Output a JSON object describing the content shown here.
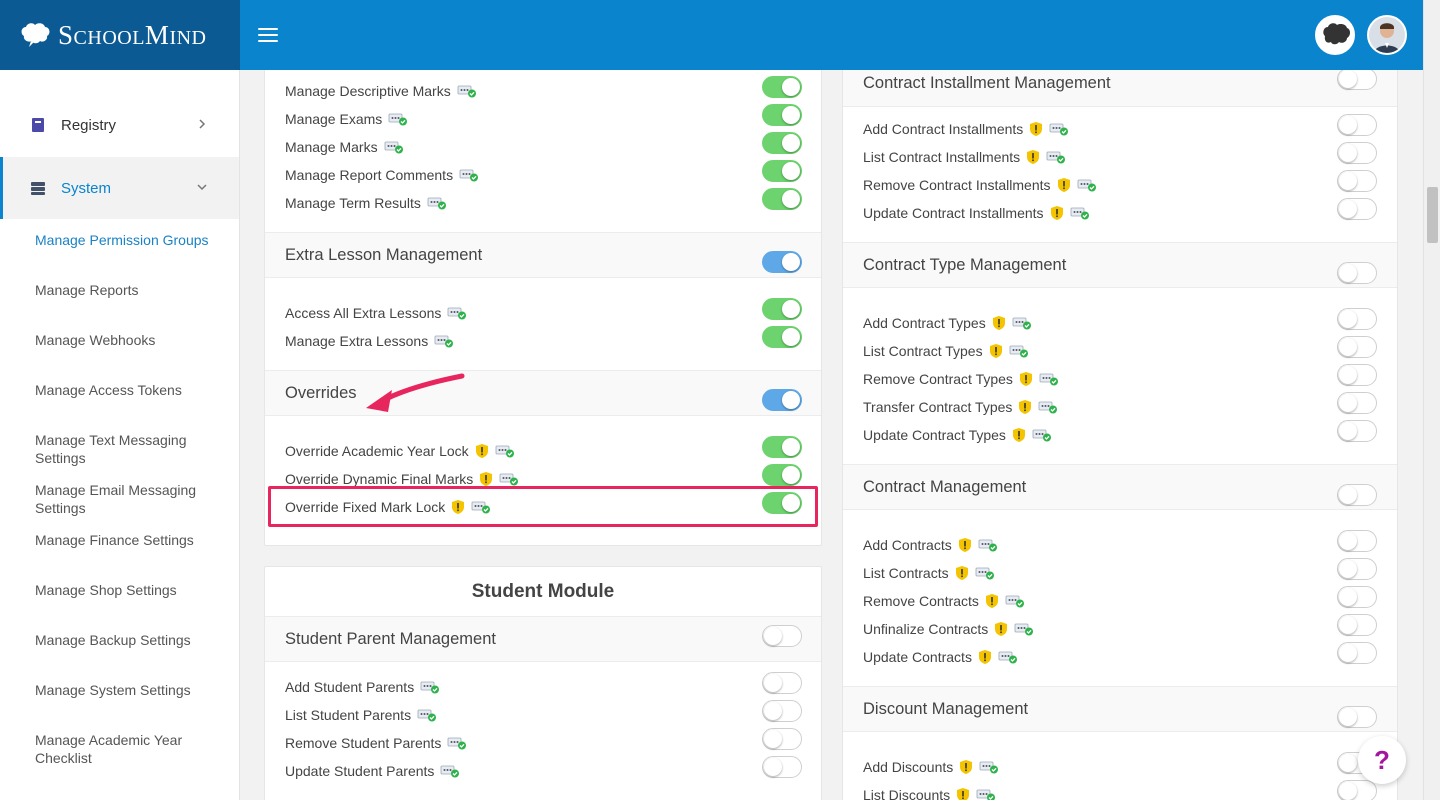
{
  "brand": {
    "logo_text_big1": "S",
    "logo_text_small1": "CHOOL",
    "logo_text_big2": "M",
    "logo_text_small2": "IND"
  },
  "sidebar": {
    "items": [
      {
        "label": "Registry"
      },
      {
        "label": "System"
      }
    ],
    "subitems": [
      "Manage Permission Groups",
      "Manage Reports",
      "Manage Webhooks",
      "Manage Access Tokens",
      "Manage Text Messaging Settings",
      "Manage Email Messaging Settings",
      "Manage Finance Settings",
      "Manage Shop Settings",
      "Manage Backup Settings",
      "Manage System Settings",
      "Manage Academic Year Checklist"
    ]
  },
  "left_column": {
    "exam_rows": [
      {
        "label": "Manage Descriptive Marks",
        "warn": false,
        "enabled": true
      },
      {
        "label": "Manage Exams",
        "warn": false,
        "enabled": true
      },
      {
        "label": "Manage Marks",
        "warn": false,
        "enabled": true
      },
      {
        "label": "Manage Report Comments",
        "warn": false,
        "enabled": true
      },
      {
        "label": "Manage Term Results",
        "warn": false,
        "enabled": true
      }
    ],
    "extra_lesson": {
      "title": "Extra Lesson Management",
      "enabled": true,
      "rows": [
        {
          "label": "Access All Extra Lessons",
          "warn": false,
          "enabled": true
        },
        {
          "label": "Manage Extra Lessons",
          "warn": false,
          "enabled": true
        }
      ]
    },
    "overrides": {
      "title": "Overrides",
      "enabled": true,
      "rows": [
        {
          "label": "Override Academic Year Lock",
          "warn": true,
          "enabled": true
        },
        {
          "label": "Override Dynamic Final Marks",
          "warn": true,
          "enabled": true
        },
        {
          "label": "Override Fixed Mark Lock",
          "warn": true,
          "enabled": true
        }
      ]
    },
    "student_module": {
      "title": "Student Module",
      "section_title": "Student Parent Management",
      "enabled": false,
      "rows": [
        {
          "label": "Add Student Parents",
          "warn": false,
          "enabled": false
        },
        {
          "label": "List Student Parents",
          "warn": false,
          "enabled": false
        },
        {
          "label": "Remove Student Parents",
          "warn": false,
          "enabled": false
        },
        {
          "label": "Update Student Parents",
          "warn": false,
          "enabled": false
        }
      ]
    }
  },
  "right_column": {
    "installments": {
      "title": "Contract Installment Management",
      "enabled": false,
      "rows": [
        {
          "label": "Add Contract Installments",
          "warn": true,
          "enabled": false
        },
        {
          "label": "List Contract Installments",
          "warn": true,
          "enabled": false
        },
        {
          "label": "Remove Contract Installments",
          "warn": true,
          "enabled": false
        },
        {
          "label": "Update Contract Installments",
          "warn": true,
          "enabled": false
        }
      ]
    },
    "contract_types": {
      "title": "Contract Type Management",
      "enabled": false,
      "rows": [
        {
          "label": "Add Contract Types",
          "warn": true,
          "enabled": false
        },
        {
          "label": "List Contract Types",
          "warn": true,
          "enabled": false
        },
        {
          "label": "Remove Contract Types",
          "warn": true,
          "enabled": false
        },
        {
          "label": "Transfer Contract Types",
          "warn": true,
          "enabled": false
        },
        {
          "label": "Update Contract Types",
          "warn": true,
          "enabled": false
        }
      ]
    },
    "contracts": {
      "title": "Contract Management",
      "enabled": false,
      "rows": [
        {
          "label": "Add Contracts",
          "warn": true,
          "enabled": false
        },
        {
          "label": "List Contracts",
          "warn": true,
          "enabled": false
        },
        {
          "label": "Remove Contracts",
          "warn": true,
          "enabled": false
        },
        {
          "label": "Unfinalize Contracts",
          "warn": true,
          "enabled": false
        },
        {
          "label": "Update Contracts",
          "warn": true,
          "enabled": false
        }
      ]
    },
    "discounts": {
      "title": "Discount Management",
      "enabled": false,
      "rows": [
        {
          "label": "Add Discounts",
          "warn": true,
          "enabled": false
        },
        {
          "label": "List Discounts",
          "warn": true,
          "enabled": false
        }
      ]
    }
  },
  "help": {
    "label": "?"
  },
  "colors": {
    "brand_dark": "#0b5a94",
    "brand": "#0a84cc",
    "toggle_green": "#6dd36e",
    "toggle_blue": "#5ea8e8",
    "highlight": "#e8265e",
    "warn": "#f5c400"
  }
}
